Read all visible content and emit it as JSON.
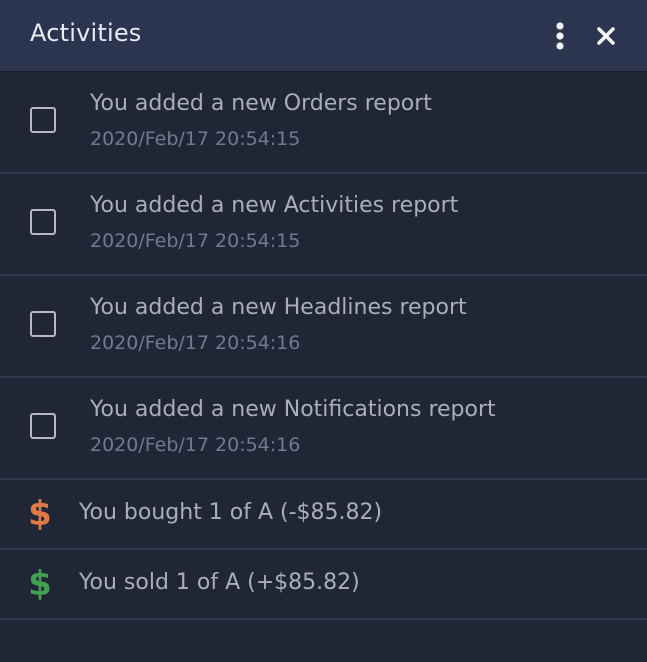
{
  "header": {
    "title": "Activities",
    "more_icon": "vertical-ellipsis-icon",
    "close_icon": "close-icon"
  },
  "reports": [
    {
      "title": "You added a new Orders report",
      "time": "2020/Feb/17 20:54:15"
    },
    {
      "title": "You added a new Activities report",
      "time": "2020/Feb/17 20:54:15"
    },
    {
      "title": "You added a new Headlines report",
      "time": "2020/Feb/17 20:54:16"
    },
    {
      "title": "You added a new Notifications report",
      "time": "2020/Feb/17 20:54:16"
    }
  ],
  "trades": [
    {
      "icon": "dollar-icon",
      "symbol": "$",
      "color": "#e07a45",
      "text": "You bought 1 of A (-$85.82)"
    },
    {
      "icon": "dollar-icon",
      "symbol": "$",
      "color": "#3fa052",
      "text": "You sold 1 of A (+$85.82)"
    }
  ],
  "colors": {
    "header_bg": "#2c3550",
    "panel_bg": "#212637",
    "divider": "#33394c"
  }
}
